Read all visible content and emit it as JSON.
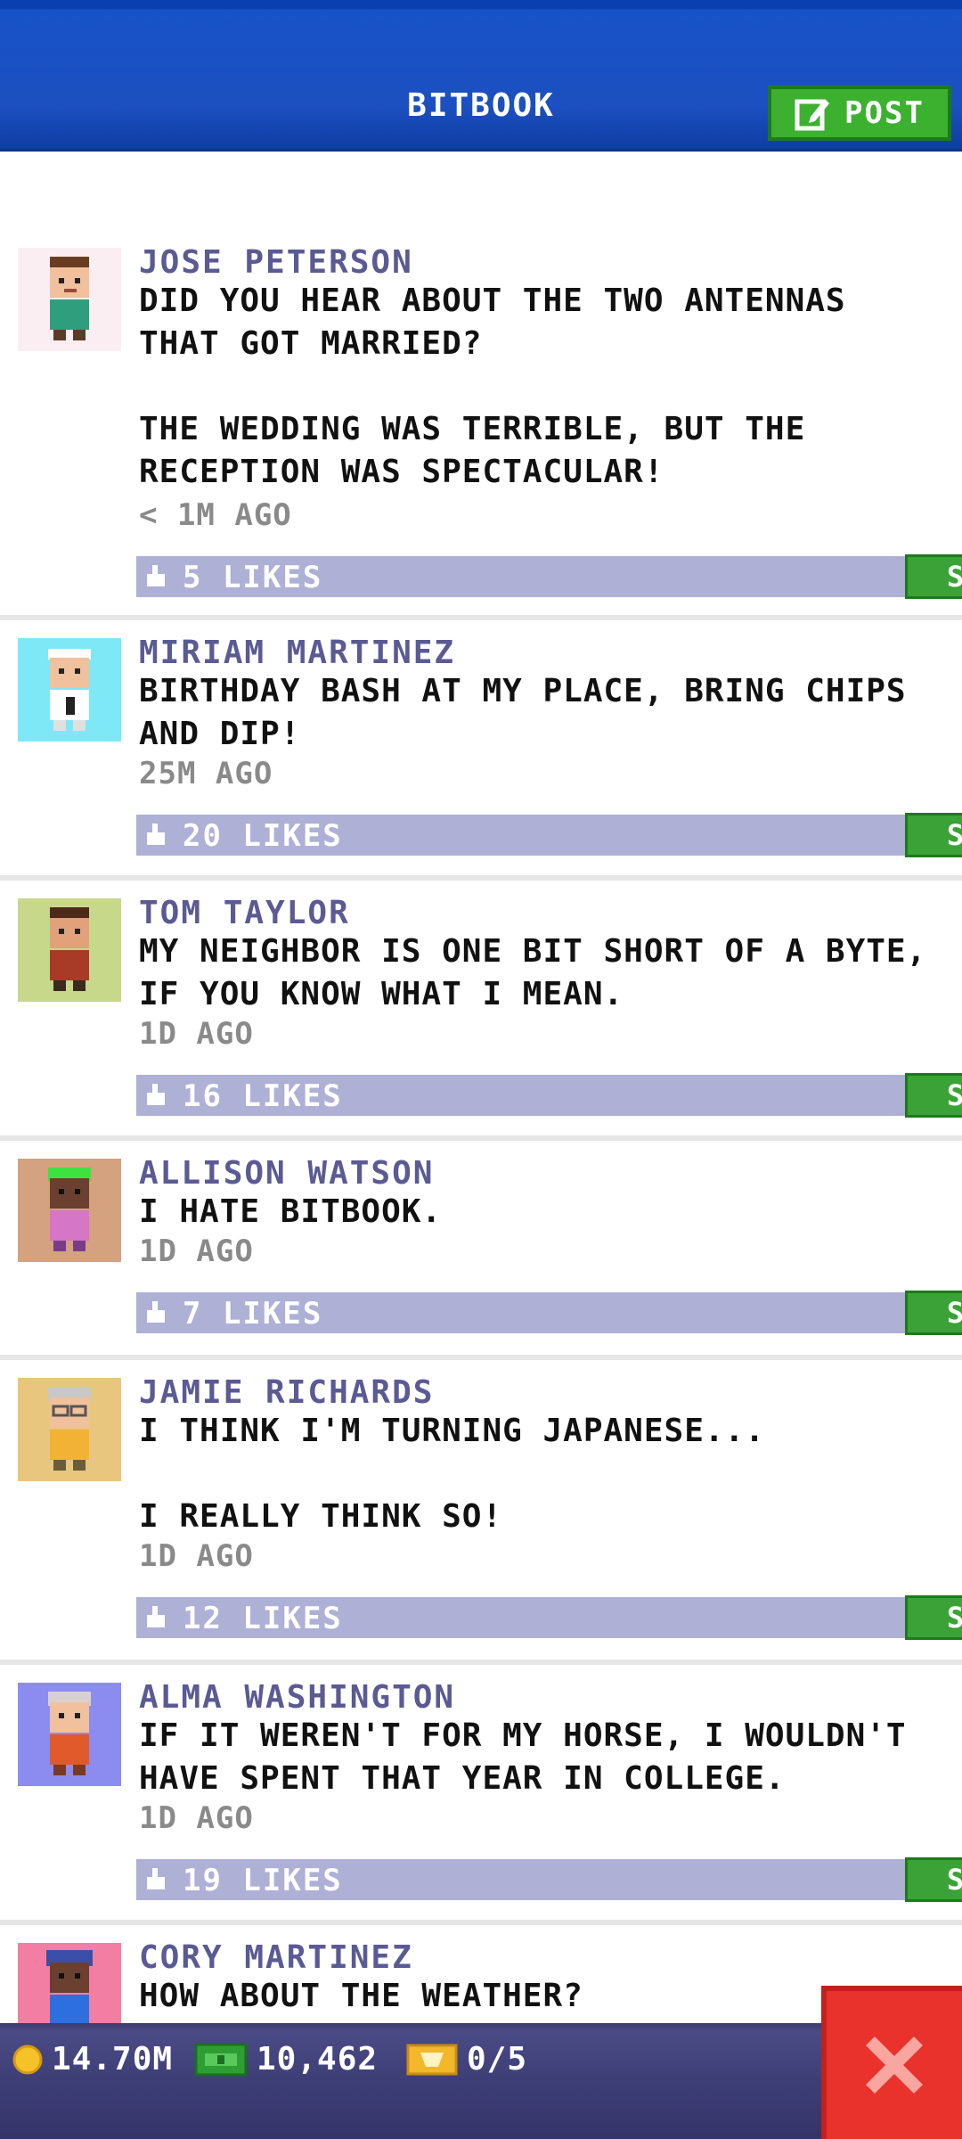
{
  "header": {
    "title": "BITBOOK",
    "post_label": "POST"
  },
  "posts": [
    {
      "author": "JOSE PETERSON",
      "body": "DID YOU HEAR ABOUT THE TWO ANTENNAS THAT GOT MARRIED?\n\nTHE WEDDING WAS TERRIBLE, BUT THE RECEPTION WAS SPECTACULAR!",
      "time": "< 1M AGO",
      "likes": "5 LIKES",
      "share": "SHARE",
      "avatar_bg": "#fbeef2"
    },
    {
      "author": "MIRIAM MARTINEZ",
      "body": "BIRTHDAY BASH AT MY PLACE, BRING CHIPS AND DIP!",
      "time": "25M AGO",
      "likes": "20 LIKES",
      "share": "SHARE",
      "avatar_bg": "#7fe8f6"
    },
    {
      "author": "TOM TAYLOR",
      "body": "MY NEIGHBOR IS ONE BIT SHORT OF A BYTE, IF YOU KNOW WHAT I MEAN.",
      "time": "1D AGO",
      "likes": "16 LIKES",
      "share": "SHARE",
      "avatar_bg": "#c7d88b"
    },
    {
      "author": "ALLISON WATSON",
      "body": "I HATE BITBOOK.",
      "time": "1D AGO",
      "likes": "7 LIKES",
      "share": "SHARE",
      "avatar_bg": "#d4a27e"
    },
    {
      "author": "JAMIE RICHARDS",
      "body": "I THINK I'M TURNING JAPANESE...\n\nI REALLY THINK SO!",
      "time": "1D AGO",
      "likes": "12 LIKES",
      "share": "SHARE",
      "avatar_bg": "#e8c67d"
    },
    {
      "author": "ALMA WASHINGTON",
      "body": "IF IT WEREN'T FOR MY HORSE, I WOULDN'T HAVE SPENT THAT YEAR IN COLLEGE.",
      "time": "1D AGO",
      "likes": "19 LIKES",
      "share": "SHARE",
      "avatar_bg": "#8c8cf0"
    },
    {
      "author": "CORY MARTINEZ",
      "body": "HOW ABOUT THE WEATHER?",
      "time": "",
      "likes": "",
      "share": "",
      "avatar_bg": "#f27fa3"
    }
  ],
  "bottom": {
    "coins": "14.70M",
    "bux": "10,462",
    "tickets": "0/5"
  },
  "colors": {
    "header": "#1c4fc0",
    "accent_green": "#3aa236",
    "likes_bar": "#aeb0d6",
    "author": "#5a5a94",
    "close_red": "#e8322b"
  },
  "icons": {
    "post": "edit-icon",
    "like": "thumbs-up-icon",
    "coin": "coin-icon",
    "bux": "bux-icon",
    "ticket": "ticket-icon",
    "close": "close-icon"
  }
}
